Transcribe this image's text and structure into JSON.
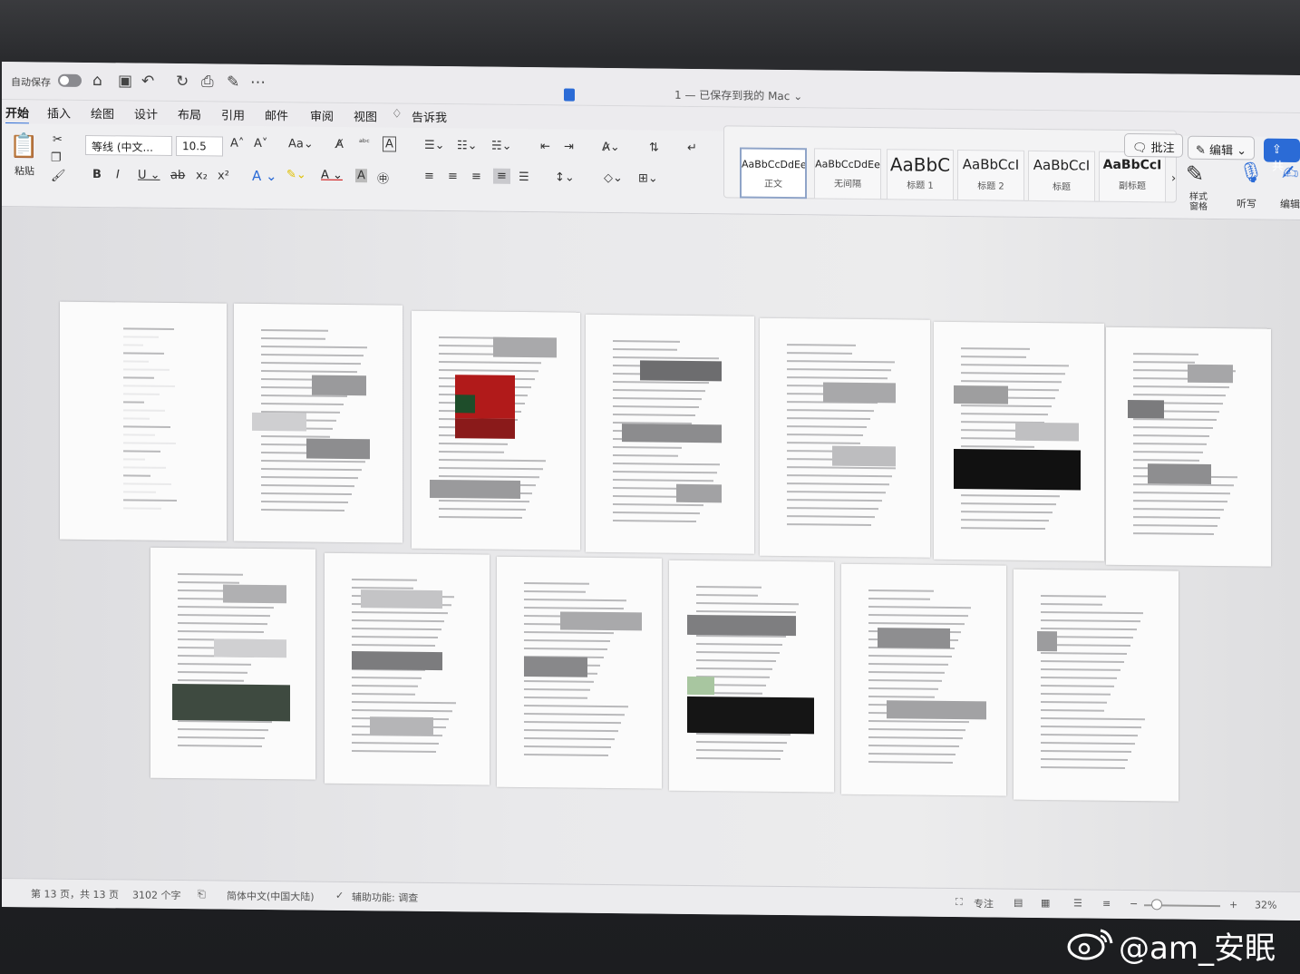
{
  "titlebar": {
    "autosave_label": "自动保存",
    "doc_title": "1 — 已保存到我的 Mac ⌄"
  },
  "tabs": [
    "开始",
    "插入",
    "绘图",
    "设计",
    "布局",
    "引用",
    "邮件",
    "审阅",
    "视图",
    "告诉我"
  ],
  "ribbon": {
    "paste_label": "粘贴",
    "font_name": "等线 (中文...",
    "font_size": "10.5",
    "styles": [
      {
        "sample": "AaBbCcDdEe",
        "name": "正文"
      },
      {
        "sample": "AaBbCcDdEe",
        "name": "无间隔"
      },
      {
        "sample": "AaBbC",
        "name": "标题 1"
      },
      {
        "sample": "AaBbCcI",
        "name": "标题 2"
      },
      {
        "sample": "AaBbCcI",
        "name": "标题"
      },
      {
        "sample": "AaBbCcI",
        "name": "副标题"
      }
    ],
    "style_pane_label": "样式\n窗格",
    "dictate_label": "听写",
    "editor_label": "编辑",
    "comments_label": "批注",
    "editing_label": "编辑",
    "share_label": "共"
  },
  "status": {
    "page": "第 13 页，共 13 页",
    "words": "3102 个字",
    "language": "简体中文(中国大陆)",
    "accessibility": "辅助功能: 调查",
    "focus": "专注",
    "zoom": "32%"
  },
  "watermark": "@am_安眠"
}
